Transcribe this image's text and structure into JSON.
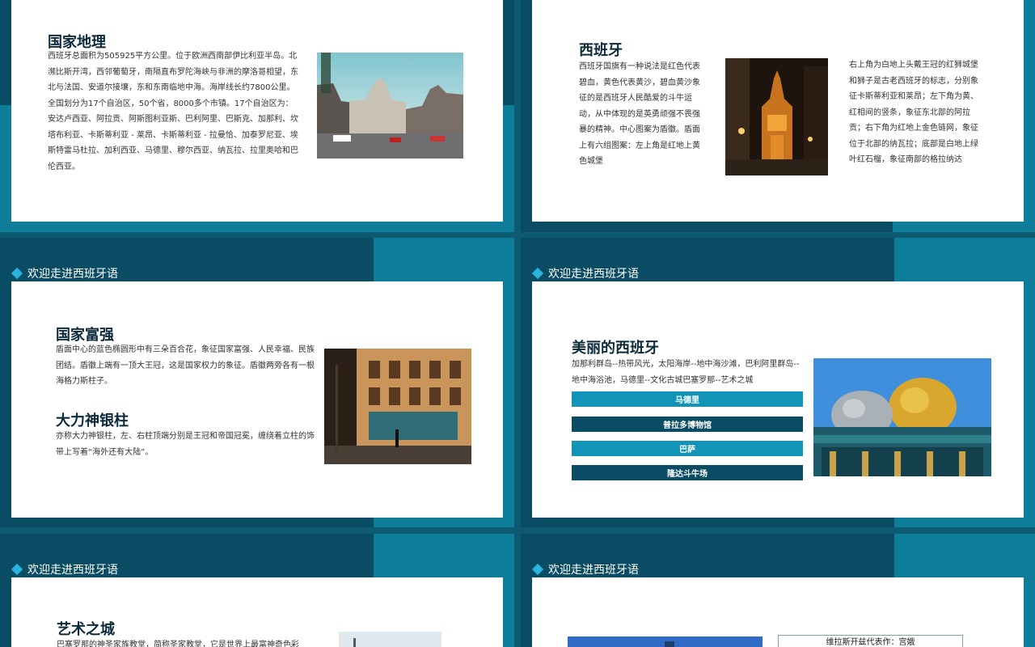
{
  "header_label": "欢迎走进西班牙语",
  "slides": {
    "geo": {
      "title": "国家地理",
      "text": "西班牙总面积为505925平方公里。位于欧洲西南部伊比利亚半岛。北濒比斯开湾，西邻葡萄牙，南隔直布罗陀海峡与非洲的摩洛哥相望，东北与法国、安道尔接壤，东和东南临地中海。海岸线长约7800公里。全国划分为17个自治区，50个省，8000多个市镇。17个自治区为：安达卢西亚、阿拉贡、阿斯图利亚斯、巴利阿里、巴斯克、加那利、坎塔布利亚、卡斯蒂利亚 - 莱昂、卡斯蒂利亚 - 拉曼恰、加泰罗尼亚、埃斯特雷马杜拉、加利西亚、马德里、穆尔西亚、纳瓦拉、拉里奥哈和巴伦西亚。",
      "photo_icon": "city-street-photo"
    },
    "spain": {
      "title": "西班牙",
      "text_left": "西班牙国旗有一种说法是红色代表碧血，黄色代表黄沙，碧血黄沙象征的是西班牙人民酷爱的斗牛运动，从中体现的是英勇顽强不畏强暴的精神。中心图案为盾徽。盾面上有六组图案：左上角是红地上黄色城堡",
      "text_right": "右上角为白地上头戴王冠的红狮城堡和狮子是古老西班牙的标志，分别象征卡斯蒂利亚和莱昂；左下角为黄、红相间的竖条，象征东北部的阿拉贡；右下角为红地上金色链网，象征位于北部的纳瓦拉；底部是白地上绿叶红石榴，象征南部的格拉纳达",
      "photo_icon": "night-church-photo"
    },
    "strong": {
      "title1": "国家富强",
      "text1": "盾面中心的蓝色椭圆形中有三朵百合花，象征国家富强、人民幸福、民族团结。盾徽上端有一顶大王冠，这是国家权力的象征。盾徽两旁各有一根海格力斯柱子。",
      "title2": "大力神银柱",
      "text2": "亦称大力神银柱，左、右柱顶端分别是王冠和帝国冠冕，缠绕着立柱的饰带上写着“海外还有大陆”。",
      "photo_icon": "building-photo"
    },
    "beauty": {
      "title": "美丽的西班牙",
      "text": "加那利群岛--热带风光，太阳海岸--地中海沙滩，巴利阿里群岛--地中海浴池，马德里--文化古城巴塞罗那--艺术之城",
      "items": [
        "马德里",
        "普拉多博物馆",
        "巴萨",
        "隆达斗牛场"
      ],
      "photo_icon": "golden-dome-photo"
    },
    "art": {
      "title": "艺术之城",
      "text": "巴塞罗那的神圣家族教堂，简称圣家教堂，它是世界上最富神奇色彩"
    },
    "last": {
      "box_label": "维拉斯开兹代表作：宫娥"
    }
  }
}
